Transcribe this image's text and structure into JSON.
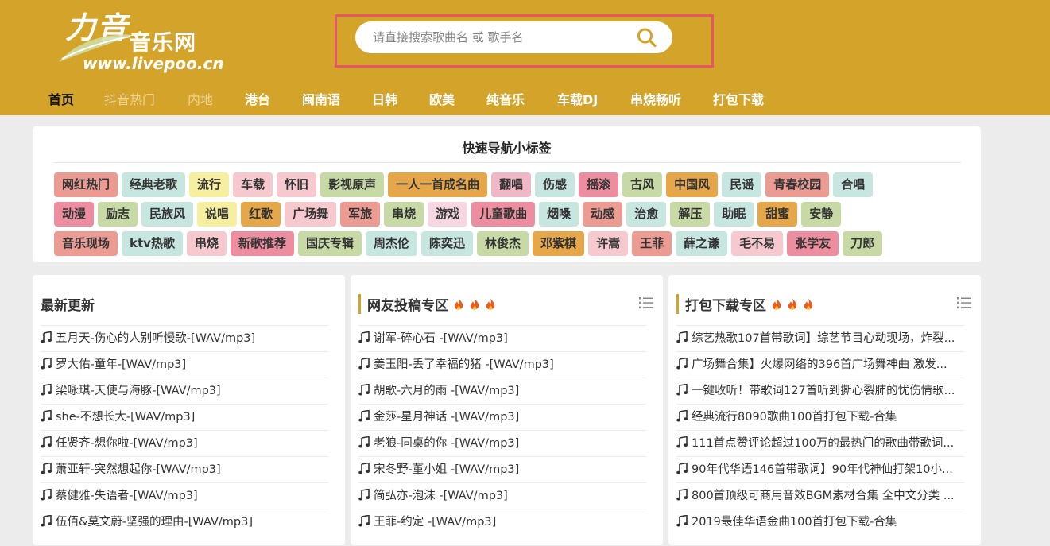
{
  "logo": {
    "big": "力音",
    "name": "音乐网",
    "site": "www.livepoo.cn"
  },
  "search": {
    "placeholder": "请直接搜索歌曲名 或 歌手名"
  },
  "nav": [
    "首页",
    "抖音热门",
    "内地",
    "港台",
    "闽南语",
    "日韩",
    "欧美",
    "纯音乐",
    "车载DJ",
    "串烧畅听",
    "打包下载"
  ],
  "quicknav": {
    "title": "快速导航小标签",
    "rows": [
      [
        "网红热门",
        "经典老歌",
        "流行",
        "车载",
        "怀旧",
        "影视原声",
        "一人一首成名曲",
        "翻唱",
        "伤感",
        "摇滚",
        "古风",
        "中国风",
        "民谣",
        "青春校园",
        "合唱"
      ],
      [
        "动漫",
        "励志",
        "民族风",
        "说唱",
        "红歌",
        "广场舞",
        "军旅",
        "串烧",
        "游戏",
        "儿童歌曲",
        "烟嗓",
        "动感",
        "治愈",
        "解压",
        "助眠",
        "甜蜜",
        "安静"
      ],
      [
        "音乐现场",
        "ktv热歌",
        "串烧",
        "新歌推荐",
        "国庆专辑",
        "周杰伦",
        "陈奕迅",
        "林俊杰",
        "邓紫棋",
        "许嵩",
        "王菲",
        "薛之谦",
        "毛不易",
        "张学友",
        "刀郎"
      ]
    ],
    "colors": [
      [
        "#ec9b92",
        "#c8e6e0",
        "#f7efa0",
        "#f6c9cf",
        "#f6c9cf",
        "#c7d9a4",
        "#e6a74a",
        "#f0b7c6",
        "#c8e6e0",
        "#ec8ea0",
        "#c7d9a4",
        "#e6a74a",
        "#c8e6e0",
        "#ec9b92",
        "#c8e6e0"
      ],
      [
        "#ec8ea0",
        "#c7d9a4",
        "#c8e6e0",
        "#f7efa0",
        "#e6a74a",
        "#f6c9cf",
        "#ec9b92",
        "#c7d9a4",
        "#f6d6e0",
        "#ec8ea0",
        "#c8e6e0",
        "#ec9b92",
        "#c8e6e0",
        "#c7d9a4",
        "#c8e6e0",
        "#e6a74a",
        "#c7d9a4"
      ],
      [
        "#ec9b92",
        "#c8e6e0",
        "#f6c9cf",
        "#ec8ea0",
        "#c7d9a4",
        "#c8e6e0",
        "#c8e6e0",
        "#c7d9a4",
        "#e6a74a",
        "#f6c9cf",
        "#ec9b92",
        "#c8e6e0",
        "#f6c9cf",
        "#ec8ea0",
        "#c7d9a4"
      ]
    ]
  },
  "panels": [
    {
      "title": "最新更新",
      "items": [
        "五月天-伤心的人别听慢歌-[WAV/mp3]",
        "罗大佑-童年-[WAV/mp3]",
        "梁咏琪-天使与海豚-[WAV/mp3]",
        "she-不想长大-[WAV/mp3]",
        "任贤齐-想你啦-[WAV/mp3]",
        "萧亚轩-突然想起你-[WAV/mp3]",
        "蔡健雅-失语者-[WAV/mp3]",
        "伍佰&莫文蔚-坚强的理由-[WAV/mp3]"
      ]
    },
    {
      "title": "网友投稿专区",
      "items": [
        "谢军-碎心石 -[WAV/mp3]",
        "姜玉阳-丢了幸福的猪 -[WAV/mp3]",
        "胡歌-六月的雨 -[WAV/mp3]",
        "金莎-星月神话 -[WAV/mp3]",
        "老狼-同桌的你 -[WAV/mp3]",
        "宋冬野-董小姐 -[WAV/mp3]",
        "简弘亦-泡沫 -[WAV/mp3]",
        "王菲-约定 -[WAV/mp3]"
      ]
    },
    {
      "title": "打包下载专区",
      "items": [
        "综艺热歌107首带歌词】综艺节目心动现场，炸裂...",
        "广场舞合集】火爆网络的396首广场舞神曲 激发...",
        "一键收听！带歌词127首听到撕心裂肺的忧伤情歌...",
        "经典流行8090歌曲100首打包下载-合集",
        "111首点赞评论超过100万的最热门的歌曲带歌词...",
        "90年代华语146首带歌词】90年代神仙打架10小...",
        "800首顶级可商用音效BGM素材合集 全中文分类 ...",
        "2019最佳华语金曲100首打包下载-合集"
      ]
    }
  ],
  "colors": {
    "header": "#d4a42a",
    "search_frame": "#e8556a",
    "flame": "#f05a1e"
  }
}
